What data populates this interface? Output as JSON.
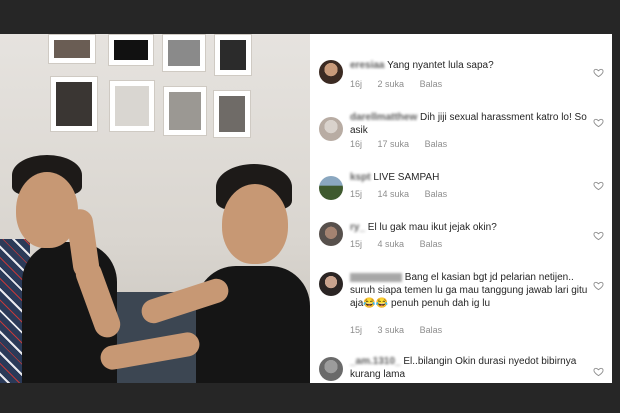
{
  "comments": [
    {
      "username": "eresiaa",
      "text": "Yang nyantet lula sapa?",
      "time": "16j",
      "likes": "2 suka",
      "reply": "Balas",
      "avatar": "avatar-girl-dark"
    },
    {
      "username": "darellmatthew",
      "text": "Dih jiji sexual harassment katro lo! So asik",
      "time": "16j",
      "likes": "17 suka",
      "reply": "Balas",
      "avatar": "avatar-light"
    },
    {
      "username": "kspt",
      "text": "LIVE SAMPAH",
      "time": "15j",
      "likes": "14 suka",
      "reply": "Balas",
      "avatar": "avatar-outdoor"
    },
    {
      "username": "ry_",
      "text": "El lu gak mau ikut jejak okin?",
      "time": "15j",
      "likes": "4 suka",
      "reply": "Balas",
      "avatar": "avatar-face"
    },
    {
      "username": "",
      "text": "Bang el kasian bgt jd pelarian netijen.. suruh siapa temen lu ga mau tanggung jawab lari gitu aja😂😂 penuh penuh dah ig lu",
      "time": "15j",
      "likes": "3 suka",
      "reply": "Balas",
      "avatar": "avatar-girl"
    },
    {
      "username": "_am.1310_",
      "text": "El..bilangin Okin durasi nyedot bibirnya kurang lama",
      "time": "",
      "likes": "",
      "reply": "",
      "avatar": "avatar-gray"
    }
  ],
  "colors": {
    "text": "#262626",
    "meta": "#8e8e8e",
    "heart": "#8e8e8e"
  }
}
